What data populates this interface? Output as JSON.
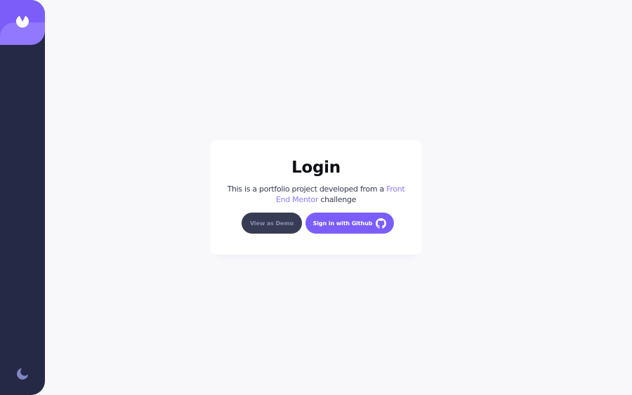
{
  "sidebar": {
    "logo_icon": "app-logo-icon",
    "theme_toggle_icon": "moon-icon"
  },
  "login": {
    "title": "Login",
    "description_before": "This is a portfolio project developed from a ",
    "link_text": "Front End Mentor",
    "description_after": " challenge",
    "demo_button": "View as Demo",
    "github_button": "Sign in with Github",
    "github_icon": "github-icon"
  },
  "colors": {
    "accent": "#7c5dfa",
    "accent_light": "#9277ff",
    "sidebar_bg": "#252945",
    "page_bg": "#f8f8fb",
    "demo_button_bg": "#373b53"
  }
}
